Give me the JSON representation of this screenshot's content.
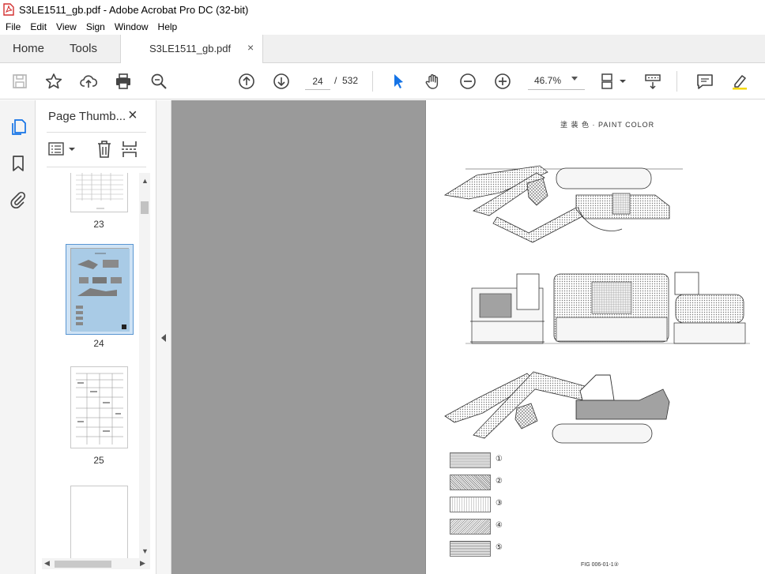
{
  "window": {
    "title": "S3LE1511_gb.pdf - Adobe Acrobat Pro DC (32-bit)"
  },
  "menu": [
    "File",
    "Edit",
    "View",
    "Sign",
    "Window",
    "Help"
  ],
  "tabs": {
    "home": "Home",
    "tools": "Tools",
    "document": "S3LE1511_gb.pdf",
    "close": "×"
  },
  "toolbar": {
    "current_page": "24",
    "page_separator": "/",
    "total_pages": "532",
    "zoom": "46.7%"
  },
  "panel": {
    "title": "Page Thumb...",
    "close": "×",
    "thumbnails": [
      {
        "label": "23"
      },
      {
        "label": "24"
      },
      {
        "label": "25"
      }
    ]
  },
  "document": {
    "heading": "塗 装 色 · PAINT COLOR",
    "legend": [
      "①",
      "②",
      "③",
      "④",
      "⑤"
    ],
    "figure_label": "FIG 006-01-1②"
  },
  "colors": {
    "accent": "#1473e6",
    "doc_background": "#9a9a9a",
    "selection": "#cfe3f5"
  }
}
